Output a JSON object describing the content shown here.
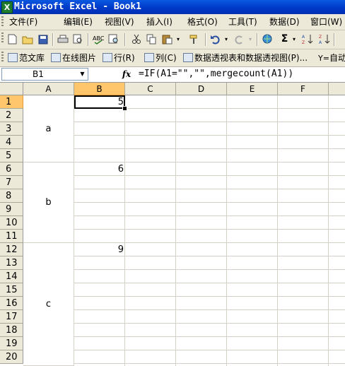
{
  "window": {
    "title": "Microsoft Excel - Book1",
    "app_icon": "excel-icon"
  },
  "menu": [
    "文件(F)",
    "编辑(E)",
    "视图(V)",
    "插入(I)",
    "格式(O)",
    "工具(T)",
    "数据(D)",
    "窗口(W)"
  ],
  "toolbar": {
    "icons": [
      "new-icon",
      "open-icon",
      "save-icon",
      "print-icon",
      "print-preview-icon",
      "spelling-icon",
      "research-icon",
      "cut-icon",
      "copy-icon",
      "paste-icon",
      "format-painter-icon",
      "undo-icon",
      "redo-icon",
      "hyperlink-icon",
      "autosum-icon",
      "sort-ascending-icon",
      "sort-descending-icon"
    ],
    "autosum_glyph": "Σ"
  },
  "toolbar2": {
    "items": [
      "范文库",
      "在线图片",
      "行(R)",
      "列(C)",
      "数据透视表和数据透视图(P)...",
      "自动"
    ]
  },
  "formula_bar": {
    "name_box": "B1",
    "fx_label": "fx",
    "formula": "=IF(A1=\"\",\"\",mergecount(A1))"
  },
  "sheet": {
    "columns": [
      "A",
      "B",
      "C",
      "D",
      "E",
      "F"
    ],
    "rows": [
      "1",
      "2",
      "3",
      "4",
      "5",
      "6",
      "7",
      "8",
      "9",
      "10",
      "11",
      "12",
      "13",
      "14",
      "15",
      "16",
      "17",
      "18",
      "19",
      "20"
    ],
    "selected_cell": "B1",
    "merged_a": [
      {
        "rows": "1-5",
        "value": "a"
      },
      {
        "rows": "6-11",
        "value": "b"
      },
      {
        "rows": "12-20",
        "value": "c"
      }
    ],
    "b_values": [
      {
        "row": "1",
        "value": "5"
      },
      {
        "row": "6",
        "value": "6"
      },
      {
        "row": "12",
        "value": "9"
      }
    ]
  }
}
